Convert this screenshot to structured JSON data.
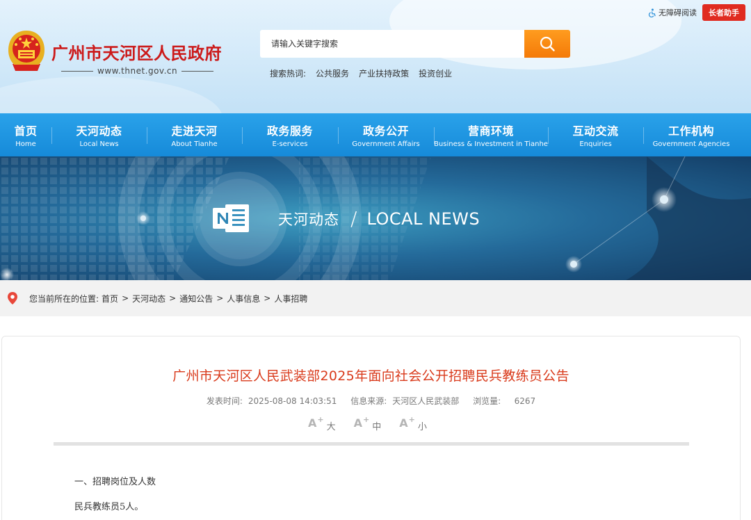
{
  "topbar": {
    "accessibility_label": "无障碍阅读",
    "elder_label": "长者助手"
  },
  "logo": {
    "title": "广州市天河区人民政府",
    "domain": "www.thnet.gov.cn"
  },
  "search": {
    "placeholder": "请输入关键字搜索",
    "hot_label": "搜索热词:",
    "hot_words": [
      "公共服务",
      "产业扶持政策",
      "投资创业"
    ]
  },
  "nav": {
    "items": [
      {
        "zh": "首页",
        "en": "Home"
      },
      {
        "zh": "天河动态",
        "en": "Local News"
      },
      {
        "zh": "走进天河",
        "en": "About Tianhe"
      },
      {
        "zh": "政务服务",
        "en": "E-services"
      },
      {
        "zh": "政务公开",
        "en": "Government Affairs"
      },
      {
        "zh": "营商环境",
        "en": "Business & Investment in Tianhe"
      },
      {
        "zh": "互动交流",
        "en": "Enquiries"
      },
      {
        "zh": "工作机构",
        "en": "Government Agencies"
      }
    ]
  },
  "banner": {
    "title_zh": "天河动态",
    "slash": "/",
    "title_en": "LOCAL NEWS"
  },
  "breadcrumb": {
    "label": "您当前所在的位置:",
    "items": [
      "首页",
      "天河动态",
      "通知公告",
      "人事信息",
      "人事招聘"
    ],
    "separator": ">"
  },
  "article": {
    "title": "广州市天河区人民武装部2025年面向社会公开招聘民兵教练员公告",
    "publish_label": "发表时间:",
    "publish_time": "2025-08-08 14:03:51",
    "source_label": "信息来源:",
    "source": "天河区人民武装部",
    "views_label": "浏览量:",
    "views": "6267",
    "font_sizes": [
      {
        "glyph": "A",
        "sup": "+",
        "label": "大"
      },
      {
        "glyph": "A",
        "sup": "+",
        "label": "中"
      },
      {
        "glyph": "A",
        "sup": "+",
        "label": "小"
      }
    ],
    "paragraphs": [
      "一、招聘岗位及人数",
      "民兵教练员5人。"
    ]
  },
  "colors": {
    "nav_blue": "#1a8fdc",
    "title_red": "#cc1a1a",
    "article_title": "#d93a1b",
    "search_orange": "#f5850f",
    "elder_red": "#e02b20"
  }
}
